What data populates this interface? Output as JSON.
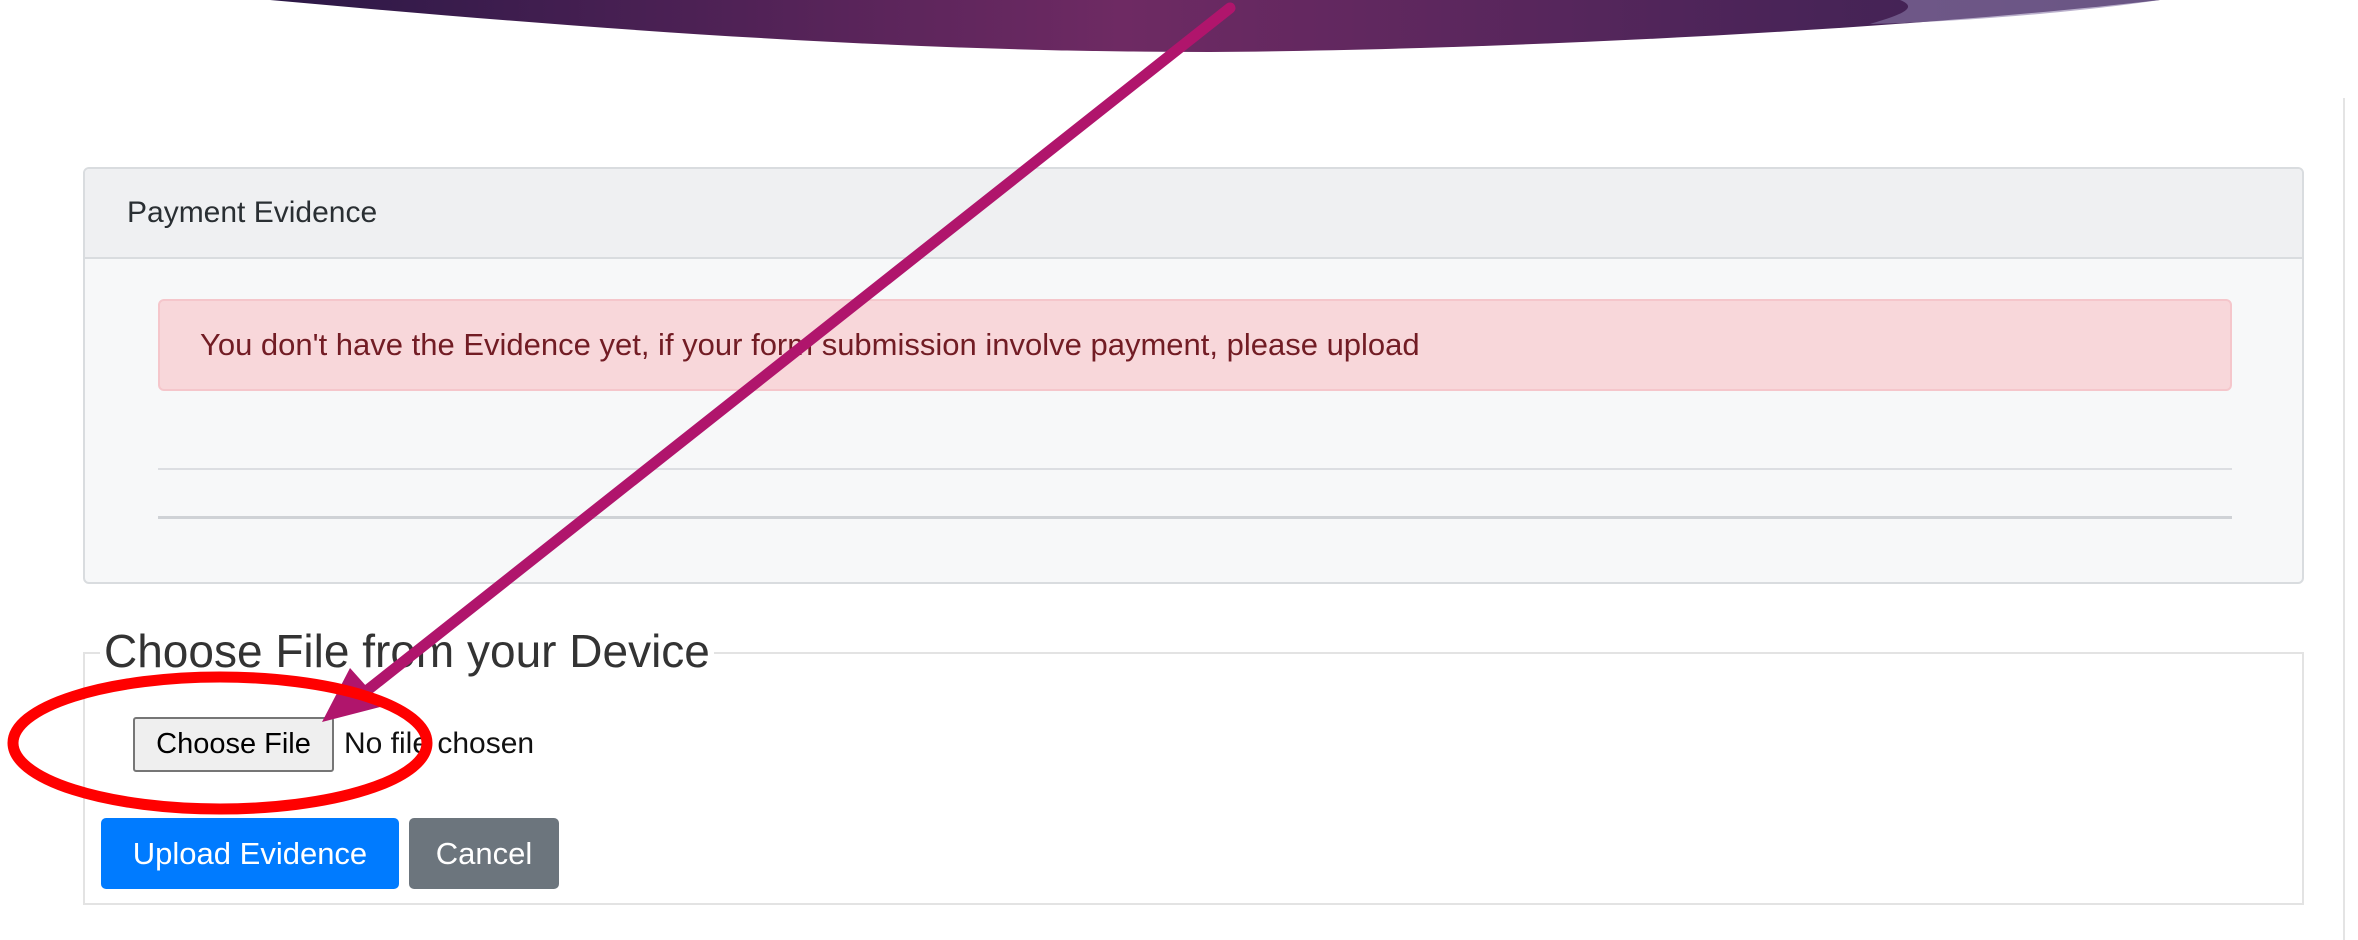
{
  "card": {
    "header": "Payment Evidence",
    "alert_text": "You don't have the Evidence yet, if your form submission involve payment, please upload"
  },
  "upload": {
    "legend": "Choose File from your Device",
    "file_button_label": "Choose File",
    "file_status": "No file chosen",
    "upload_button_label": "Upload Evidence",
    "cancel_button_label": "Cancel"
  },
  "annotation": {
    "arrow_color": "#b0156c",
    "ellipse_color": "#ff0000"
  },
  "colors": {
    "primary": "#007bff",
    "secondary": "#6c757d",
    "alert_bg": "#f8d7da",
    "alert_text": "#721c24",
    "banner_start": "#2d1a47",
    "banner_mid": "#6e2a63"
  }
}
